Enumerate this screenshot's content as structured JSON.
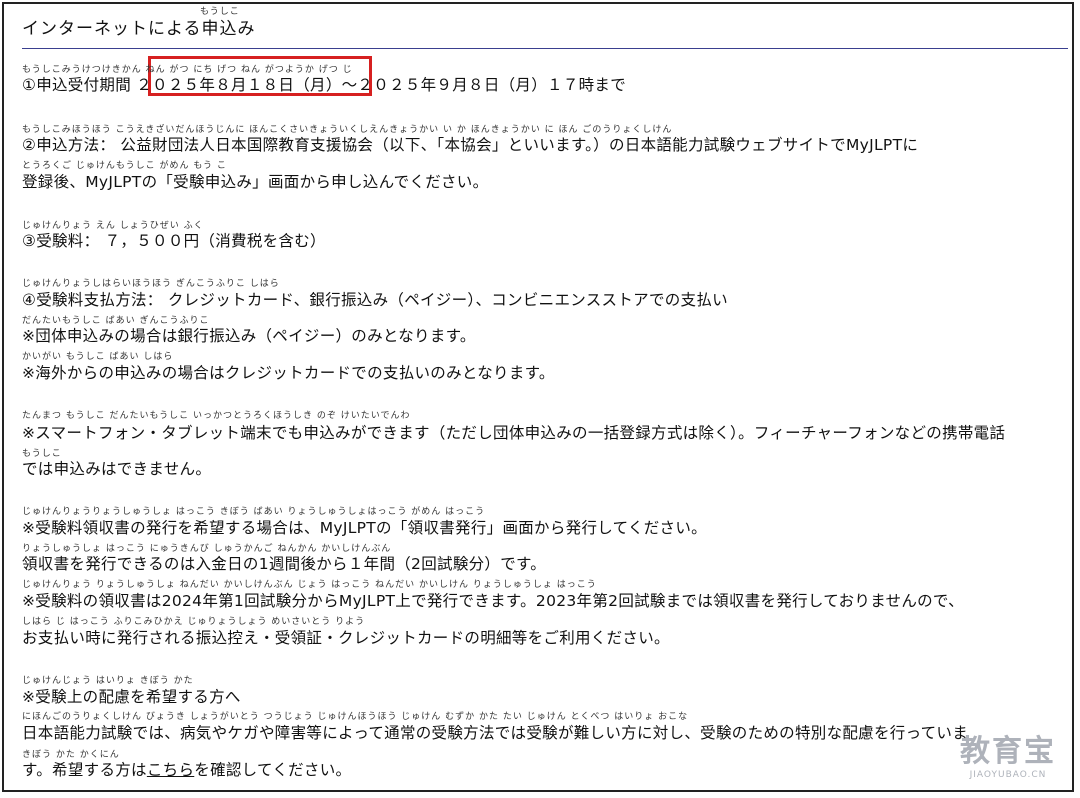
{
  "page": {
    "title_furigana": "もうしこ",
    "title": "インターネットによる申込み"
  },
  "items": [
    {
      "top": 0,
      "text": ""
    },
    {
      "furigana": "もうしこみうけつけきかん                                  ねん   がつ         にち    げつ                                          ねん    がつようか     げつ                     じ",
      "text": "①申込受付期間 ２０２５年８月１８日（月）～２０２５年９月８日（月）１７時まで"
    },
    {
      "furigana": "もうしこみほうほう                    こうえきざいだんほうじんに ほんこくさいきょういくしえんきょうかい      い   か               ほんきょうかい                                      に ほん ごのうりょくしけん",
      "text": "②申込方法： 公益財団法人日本国際教育支援協会（以下、「本協会」といいます。）の日本語能力試験ウェブサイトでMyJLPTに"
    },
    {
      "furigana": "とうろくご                                                   じゅけんもうしこ          がめん          もう    こ",
      "text": "登録後、MyJLPTの「受験申込み」画面から申し込んでください。"
    },
    {
      "furigana": "じゅけんりょう                                     えん     しょうひぜい     ふく",
      "text": "③受験料： ７，５００円（消費税を含む）"
    },
    {
      "furigana": "じゅけんりょうしはらいほうほう                                              ぎんこうふりこ                                                                                                     しはら",
      "text": "④受験料支払方法： クレジットカード、銀行振込み（ペイジー）、コンビニエンスストアでの支払い"
    },
    {
      "furigana": "だんたいもうしこ               ばあい     ぎんこうふりこ",
      "text": "※団体申込みの場合は銀行振込み（ペイジー）のみとなります。"
    },
    {
      "furigana": "かいがい                   もうしこ              ばあい                                             しはら",
      "text": "※海外からの申込みの場合はクレジットカードでの支払いのみとなります。"
    },
    {
      "furigana": "たんまつ              もうしこ                                           だんたいもうしこ                 いっかつとうろくほうしき       のぞ                                                                      けいたいでんわ",
      "text": "※スマートフォン・タブレット端末でも申込みができます（ただし団体申込みの一括登録方式は除く）。フィーチャーフォンなどの携帯電話"
    },
    {
      "furigana": "もうしこ",
      "text": "では申込みはできません。"
    },
    {
      "furigana": "じゅけんりょうりょうしゅうしょ         はっこう          きぼう                  ばあい                                          りょうしゅうしょはっこう        がめん             はっこう",
      "text": "※受験料領収書の発行を希望する場合は、MyJLPTの「領収書発行」画面から発行してください。"
    },
    {
      "furigana": "りょうしゅうしょ          はっこう                                    にゅうきんび           しゅうかんご                      ねんかん          かいしけんぶん",
      "text": "領収書を発行できるのは入金日の1週間後から１年間（2回試験分）です。"
    },
    {
      "furigana": "じゅけんりょう     りょうしゅうしょ                             ねんだい  かいしけんぶん                              じょう      はっこう                                           ねんだい    かいしけん                                 りょうしゅうしょ       はっこう",
      "text": "※受験料の領収書は2024年第1回試験分からMyJLPT上で発行できます。2023年第2回試験までは領収書を発行しておりませんので、"
    },
    {
      "furigana": "しはら      じ       はっこう                  ふりこみひかえ        じゅりょうしょう                           めいさいとう              りよう",
      "text": "お支払い時に発行される振込控え・受領証・クレジットカードの明細等をご利用ください。"
    },
    {
      "furigana": "じゅけんじょう          はいりょ      きぼう                かた",
      "text": "※受験上の配慮を希望する方へ"
    },
    {
      "furigana": "にほんごのうりょくしけん                                 びょうき                               しょうがいとう                           つうじょう       じゅけんほうほう                  じゅけん      むずか                 かた       たい                 じゅけん                                  とくべつ        はいりょ         おこな",
      "text": "日本語能力試験では、病気やケガや障害等によって通常の受験方法では受験が難しい方に対し、受験のための特別な配慮を行っていま"
    },
    {
      "furigana": "きぼう              かた                                  かくにん",
      "text_before": "す。希望する方は",
      "link": "こちら",
      "text_after": "を確認してください。"
    }
  ],
  "watermark": {
    "logo": "教育宝",
    "sub": "JIAOYUBAO.CN"
  }
}
